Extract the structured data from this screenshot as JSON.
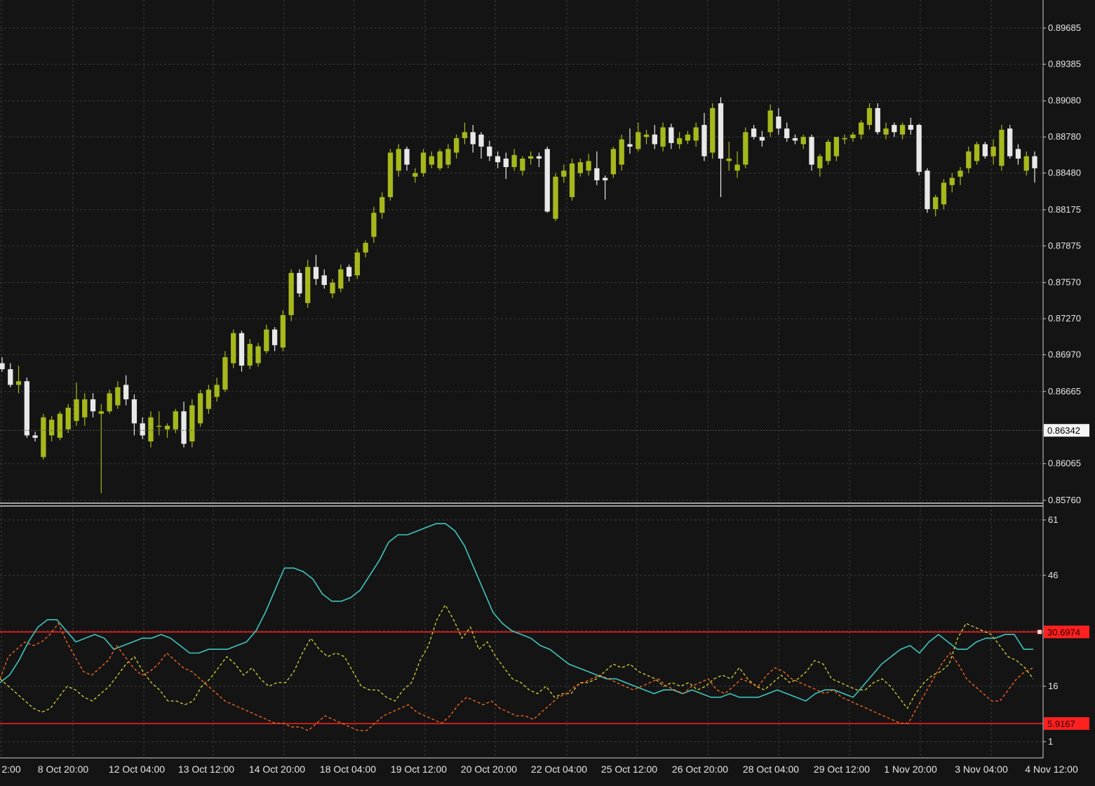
{
  "chart_data": [
    {
      "type": "candlestick",
      "price_axis": {
        "ticks": [
          "0.89685",
          "0.89385",
          "0.89080",
          "0.88780",
          "0.88480",
          "0.88175",
          "0.87875",
          "0.87570",
          "0.87270",
          "0.86970",
          "0.86665",
          "0.86065",
          "0.85760"
        ],
        "ylim": [
          0.8566,
          0.8987
        ]
      },
      "current_price_label": "0.86342",
      "current_price": 0.86342,
      "time_axis": {
        "labels": [
          "2:00",
          "8 Oct 20:00",
          "12 Oct 04:00",
          "13 Oct 12:00",
          "14 Oct 20:00",
          "18 Oct 04:00",
          "19 Oct 12:00",
          "20 Oct 20:00",
          "22 Oct 04:00",
          "25 Oct 12:00",
          "26 Oct 20:00",
          "28 Oct 04:00",
          "29 Oct 12:00",
          "1 Nov 20:00",
          "3 Nov 04:00",
          "4 Nov 12:00"
        ]
      },
      "colors": {
        "bull": "#a6b81c",
        "bear": "#e8e8e8",
        "grid": "#3a3a3a",
        "text": "#e6e6e6"
      },
      "candles": [
        [
          0.869,
          0.8695,
          0.8683,
          0.8685
        ],
        [
          0.8685,
          0.869,
          0.867,
          0.8672
        ],
        [
          0.8672,
          0.8688,
          0.8665,
          0.8675
        ],
        [
          0.8675,
          0.8678,
          0.8628,
          0.863
        ],
        [
          0.863,
          0.8633,
          0.8625,
          0.8628
        ],
        [
          0.8612,
          0.8648,
          0.861,
          0.8645
        ],
        [
          0.863,
          0.8646,
          0.8625,
          0.8643
        ],
        [
          0.8628,
          0.865,
          0.8626,
          0.8648
        ],
        [
          0.8635,
          0.8656,
          0.8632,
          0.8653
        ],
        [
          0.8642,
          0.8674,
          0.8638,
          0.866
        ],
        [
          0.8645,
          0.8665,
          0.8638,
          0.866
        ],
        [
          0.866,
          0.8665,
          0.8645,
          0.865
        ],
        [
          0.8648,
          0.8656,
          0.8582,
          0.865
        ],
        [
          0.865,
          0.8668,
          0.8648,
          0.8665
        ],
        [
          0.8655,
          0.8675,
          0.8652,
          0.867
        ],
        [
          0.8672,
          0.868,
          0.8655,
          0.866
        ],
        [
          0.866,
          0.8664,
          0.863,
          0.864
        ],
        [
          0.864,
          0.8645,
          0.8627,
          0.863
        ],
        [
          0.8625,
          0.865,
          0.862,
          0.8645
        ],
        [
          0.8638,
          0.865,
          0.863,
          0.8638
        ],
        [
          0.8635,
          0.864,
          0.8628,
          0.8638
        ],
        [
          0.8635,
          0.8652,
          0.8632,
          0.865
        ],
        [
          0.865,
          0.8658,
          0.862,
          0.8623
        ],
        [
          0.8625,
          0.866,
          0.862,
          0.8655
        ],
        [
          0.864,
          0.8668,
          0.8637,
          0.8665
        ],
        [
          0.8652,
          0.8672,
          0.8648,
          0.8668
        ],
        [
          0.8662,
          0.8678,
          0.8658,
          0.8672
        ],
        [
          0.8668,
          0.87,
          0.8666,
          0.8695
        ],
        [
          0.869,
          0.8718,
          0.8686,
          0.8715
        ],
        [
          0.8715,
          0.8717,
          0.8683,
          0.8688
        ],
        [
          0.8688,
          0.871,
          0.8685,
          0.8706
        ],
        [
          0.869,
          0.8707,
          0.8687,
          0.8704
        ],
        [
          0.87,
          0.8722,
          0.8698,
          0.8718
        ],
        [
          0.8718,
          0.872,
          0.87,
          0.8705
        ],
        [
          0.8703,
          0.8734,
          0.87,
          0.873
        ],
        [
          0.873,
          0.8768,
          0.8725,
          0.8765
        ],
        [
          0.8765,
          0.8768,
          0.8745,
          0.8748
        ],
        [
          0.874,
          0.8776,
          0.8736,
          0.877
        ],
        [
          0.877,
          0.878,
          0.8755,
          0.876
        ],
        [
          0.8763,
          0.8768,
          0.8752,
          0.8755
        ],
        [
          0.8748,
          0.876,
          0.8744,
          0.8757
        ],
        [
          0.8752,
          0.8772,
          0.8749,
          0.8768
        ],
        [
          0.877,
          0.8772,
          0.8758,
          0.8762
        ],
        [
          0.8763,
          0.8785,
          0.876,
          0.8782
        ],
        [
          0.8782,
          0.8792,
          0.8778,
          0.879
        ],
        [
          0.8795,
          0.882,
          0.879,
          0.8815
        ],
        [
          0.8815,
          0.8832,
          0.881,
          0.8828
        ],
        [
          0.8828,
          0.8868,
          0.8825,
          0.8865
        ],
        [
          0.885,
          0.8872,
          0.8845,
          0.8868
        ],
        [
          0.8868,
          0.887,
          0.885,
          0.8855
        ],
        [
          0.8845,
          0.8852,
          0.884,
          0.8848
        ],
        [
          0.8848,
          0.8868,
          0.8845,
          0.8865
        ],
        [
          0.8855,
          0.8866,
          0.8852,
          0.8862
        ],
        [
          0.8852,
          0.8868,
          0.885,
          0.8866
        ],
        [
          0.8855,
          0.8872,
          0.8852,
          0.8868
        ],
        [
          0.8865,
          0.888,
          0.886,
          0.8877
        ],
        [
          0.8877,
          0.889,
          0.8872,
          0.8882
        ],
        [
          0.8882,
          0.8888,
          0.8865,
          0.8872
        ],
        [
          0.888,
          0.8882,
          0.886,
          0.887
        ],
        [
          0.887,
          0.8875,
          0.8858,
          0.8862
        ],
        [
          0.8862,
          0.8866,
          0.8852,
          0.8857
        ],
        [
          0.886,
          0.8865,
          0.8843,
          0.8853
        ],
        [
          0.8853,
          0.8868,
          0.885,
          0.8863
        ],
        [
          0.885,
          0.8862,
          0.8846,
          0.886
        ],
        [
          0.886,
          0.8866,
          0.8855,
          0.8862
        ],
        [
          0.8862,
          0.8865,
          0.8853,
          0.886
        ],
        [
          0.8868,
          0.887,
          0.8815,
          0.8816
        ],
        [
          0.881,
          0.8848,
          0.8808,
          0.8845
        ],
        [
          0.8845,
          0.8855,
          0.884,
          0.885
        ],
        [
          0.8828,
          0.886,
          0.8825,
          0.8856
        ],
        [
          0.8848,
          0.886,
          0.8845,
          0.8857
        ],
        [
          0.885,
          0.8864,
          0.8846,
          0.8858
        ],
        [
          0.8852,
          0.8866,
          0.8838,
          0.8842
        ],
        [
          0.8844,
          0.8846,
          0.8826,
          0.8842
        ],
        [
          0.8847,
          0.887,
          0.8844,
          0.8868
        ],
        [
          0.8855,
          0.888,
          0.885,
          0.8876
        ],
        [
          0.8872,
          0.8885,
          0.8864,
          0.887
        ],
        [
          0.8868,
          0.889,
          0.8866,
          0.8882
        ],
        [
          0.8878,
          0.8884,
          0.8872,
          0.888
        ],
        [
          0.888,
          0.8888,
          0.8868,
          0.8872
        ],
        [
          0.887,
          0.889,
          0.8866,
          0.8886
        ],
        [
          0.8886,
          0.8889,
          0.8868,
          0.8873
        ],
        [
          0.8872,
          0.8882,
          0.8868,
          0.8877
        ],
        [
          0.8875,
          0.8883,
          0.8872,
          0.888
        ],
        [
          0.8875,
          0.889,
          0.887,
          0.8886
        ],
        [
          0.8888,
          0.8898,
          0.8858,
          0.8862
        ],
        [
          0.8865,
          0.8906,
          0.886,
          0.8902
        ],
        [
          0.8906,
          0.8911,
          0.8828,
          0.886
        ],
        [
          0.8858,
          0.8874,
          0.885,
          0.886
        ],
        [
          0.885,
          0.8866,
          0.8844,
          0.8855
        ],
        [
          0.8855,
          0.8886,
          0.8852,
          0.8882
        ],
        [
          0.8885,
          0.8888,
          0.8876,
          0.8878
        ],
        [
          0.8878,
          0.8883,
          0.887,
          0.8875
        ],
        [
          0.8882,
          0.8905,
          0.8878,
          0.89
        ],
        [
          0.8895,
          0.8902,
          0.888,
          0.8885
        ],
        [
          0.8885,
          0.889,
          0.8874,
          0.8877
        ],
        [
          0.8877,
          0.888,
          0.8872,
          0.8875
        ],
        [
          0.8872,
          0.888,
          0.8868,
          0.8878
        ],
        [
          0.8878,
          0.888,
          0.885,
          0.8855
        ],
        [
          0.8852,
          0.8864,
          0.8845,
          0.8862
        ],
        [
          0.8858,
          0.8876,
          0.8855,
          0.8874
        ],
        [
          0.8862,
          0.8876,
          0.8858,
          0.8878
        ],
        [
          0.8876,
          0.888,
          0.8872,
          0.8877
        ],
        [
          0.8877,
          0.8882,
          0.8874,
          0.888
        ],
        [
          0.888,
          0.8892,
          0.8876,
          0.889
        ],
        [
          0.8888,
          0.8906,
          0.8884,
          0.8902
        ],
        [
          0.8902,
          0.8906,
          0.888,
          0.8882
        ],
        [
          0.888,
          0.889,
          0.8876,
          0.8885
        ],
        [
          0.8888,
          0.889,
          0.8878,
          0.8882
        ],
        [
          0.888,
          0.889,
          0.8876,
          0.8888
        ],
        [
          0.8888,
          0.8894,
          0.888,
          0.8884
        ],
        [
          0.8888,
          0.8889,
          0.8846,
          0.8849
        ],
        [
          0.885,
          0.8852,
          0.8815,
          0.8818
        ],
        [
          0.8818,
          0.883,
          0.8812,
          0.8828
        ],
        [
          0.8822,
          0.8843,
          0.8818,
          0.884
        ],
        [
          0.8838,
          0.8848,
          0.8832,
          0.8844
        ],
        [
          0.8845,
          0.8853,
          0.8838,
          0.885
        ],
        [
          0.8852,
          0.887,
          0.8848,
          0.8866
        ],
        [
          0.8858,
          0.8874,
          0.8855,
          0.8872
        ],
        [
          0.8872,
          0.8874,
          0.886,
          0.8862
        ],
        [
          0.8862,
          0.8876,
          0.8855,
          0.887
        ],
        [
          0.8854,
          0.8888,
          0.885,
          0.8884
        ],
        [
          0.8885,
          0.8888,
          0.886,
          0.8862
        ],
        [
          0.8868,
          0.8872,
          0.8855,
          0.886
        ],
        [
          0.885,
          0.8866,
          0.8846,
          0.8862
        ],
        [
          0.8862,
          0.8866,
          0.884,
          0.8852
        ]
      ]
    },
    {
      "type": "line",
      "y_axis": {
        "ticks": [
          "61",
          "46",
          "31",
          "16",
          "1"
        ],
        "ylim": [
          -1.5,
          62.5
        ]
      },
      "levels": [
        {
          "label": "30.6974",
          "value": 30.6974,
          "color": "#ff2020"
        },
        {
          "label": "5.9167",
          "value": 5.9167,
          "color": "#ff2020"
        }
      ],
      "series": [
        {
          "style": "solid",
          "color": "#40c4be",
          "values": [
            17,
            19,
            23,
            28,
            32,
            34,
            34,
            31,
            28,
            29,
            30,
            29,
            26,
            27,
            28,
            29,
            29,
            30,
            29,
            27,
            25,
            25,
            26,
            26,
            26,
            27,
            28,
            31,
            36,
            42,
            48,
            48,
            47,
            45,
            41,
            39,
            39,
            40,
            42,
            46,
            50,
            55,
            57,
            57,
            58,
            59,
            60,
            60,
            58,
            54,
            48,
            42,
            36,
            33,
            31,
            30,
            29,
            27,
            26,
            24,
            22,
            21,
            20,
            19,
            18,
            18,
            17,
            16,
            15,
            14,
            15,
            15,
            14,
            15,
            14,
            13,
            13,
            14,
            13,
            13,
            13,
            14,
            15,
            14,
            13,
            12,
            14,
            15,
            15,
            14,
            13,
            16,
            19,
            22,
            24,
            26,
            27,
            25,
            28,
            30,
            28,
            26,
            26,
            28,
            29,
            29,
            30,
            30,
            26,
            26
          ]
        },
        {
          "style": "dashed",
          "color": "#d6d43a",
          "values": [
            18,
            16,
            14,
            12,
            10,
            9,
            10,
            13,
            16,
            15,
            13,
            12,
            14,
            16,
            19,
            22,
            24,
            20,
            17,
            15,
            12,
            12,
            11,
            12,
            16,
            18,
            21,
            24,
            22,
            19,
            21,
            18,
            16,
            17,
            17,
            20,
            25,
            29,
            26,
            24,
            25,
            24,
            20,
            16,
            15,
            15,
            13,
            12,
            15,
            17,
            23,
            27,
            34,
            38,
            34,
            29,
            32,
            26,
            28,
            24,
            21,
            18,
            17,
            15,
            14,
            16,
            13,
            14,
            14,
            17,
            17,
            18,
            20,
            22,
            21,
            22,
            20,
            19,
            18,
            16,
            17,
            16,
            17,
            15,
            16,
            18,
            19,
            18,
            21,
            18,
            16,
            15,
            17,
            19,
            17,
            18,
            20,
            23,
            22,
            18,
            17,
            16,
            15,
            15,
            17,
            18,
            16,
            13,
            10,
            14,
            17,
            19,
            20,
            22,
            29,
            33,
            32,
            31,
            30,
            27,
            24,
            23,
            21,
            18
          ]
        },
        {
          "style": "dashed",
          "color": "#ff6a20",
          "values": [
            18,
            24,
            26,
            28,
            27,
            28,
            30,
            33,
            28,
            24,
            20,
            19,
            21,
            23,
            27,
            24,
            21,
            19,
            20,
            22,
            25,
            23,
            21,
            20,
            18,
            16,
            14,
            12,
            11,
            10,
            9,
            8,
            7,
            6,
            6,
            5,
            5,
            4,
            6,
            8,
            7,
            6,
            5,
            4,
            4,
            6,
            8,
            9,
            10,
            11,
            9,
            8,
            7,
            6,
            8,
            11,
            13,
            12,
            11,
            12,
            10,
            9,
            8,
            8,
            7,
            9,
            11,
            13,
            14,
            16,
            17,
            18,
            19,
            18,
            17,
            16,
            15,
            16,
            17,
            18,
            16,
            15,
            14,
            16,
            17,
            18,
            15,
            14,
            16,
            18,
            17,
            16,
            19,
            21,
            20,
            18,
            17,
            16,
            15,
            14,
            15,
            13,
            12,
            11,
            10,
            9,
            8,
            7,
            6,
            6,
            10,
            14,
            18,
            22,
            25,
            22,
            18,
            16,
            14,
            12,
            12,
            15,
            18,
            20,
            21
          ]
        }
      ]
    }
  ]
}
